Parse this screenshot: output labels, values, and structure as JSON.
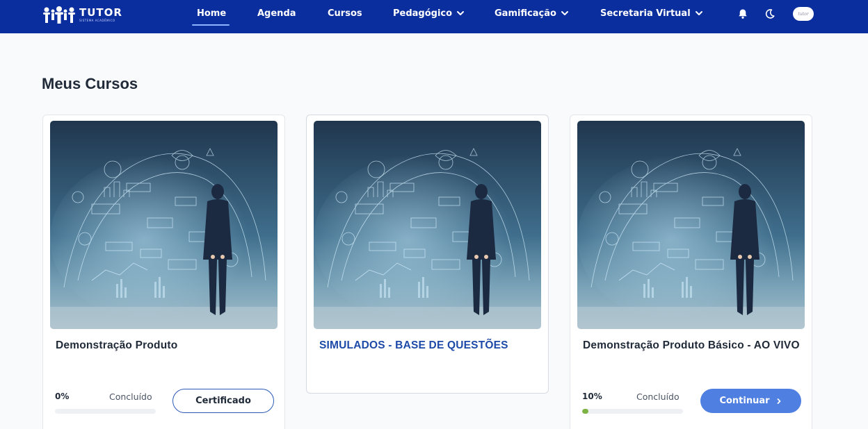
{
  "brand": {
    "name": "TUTOR",
    "subtitle": "SISTEMA ACADÊMICO"
  },
  "nav": {
    "items": [
      {
        "label": "Home",
        "active": true
      },
      {
        "label": "Agenda"
      },
      {
        "label": "Cursos"
      },
      {
        "label": "Pedagógico",
        "dropdown": true
      },
      {
        "label": "Gamificação",
        "dropdown": true
      },
      {
        "label": "Secretaria Virtual",
        "dropdown": true
      }
    ],
    "icons": [
      "bell-icon",
      "moon-icon"
    ],
    "avatar_text": "tutor"
  },
  "page": {
    "title": "Meus Cursos"
  },
  "courses": [
    {
      "title": "Demonstração Produto",
      "progress_pct": "0%",
      "progress_value": 0,
      "progress_label": "Concluído",
      "action_label": "Certificado"
    },
    {
      "title": "SIMULADOS - BASE DE QUESTÕES"
    },
    {
      "title": "Demonstração Produto Básico - AO VIVO",
      "progress_pct": "10%",
      "progress_value": 0.1,
      "progress_label": "Concluído",
      "action_label": "Continuar"
    }
  ],
  "colors": {
    "navbar": "#0b2e9e",
    "accent": "#4f7fe0",
    "progress": "#7cb342",
    "link_title": "#1d4aa8"
  }
}
